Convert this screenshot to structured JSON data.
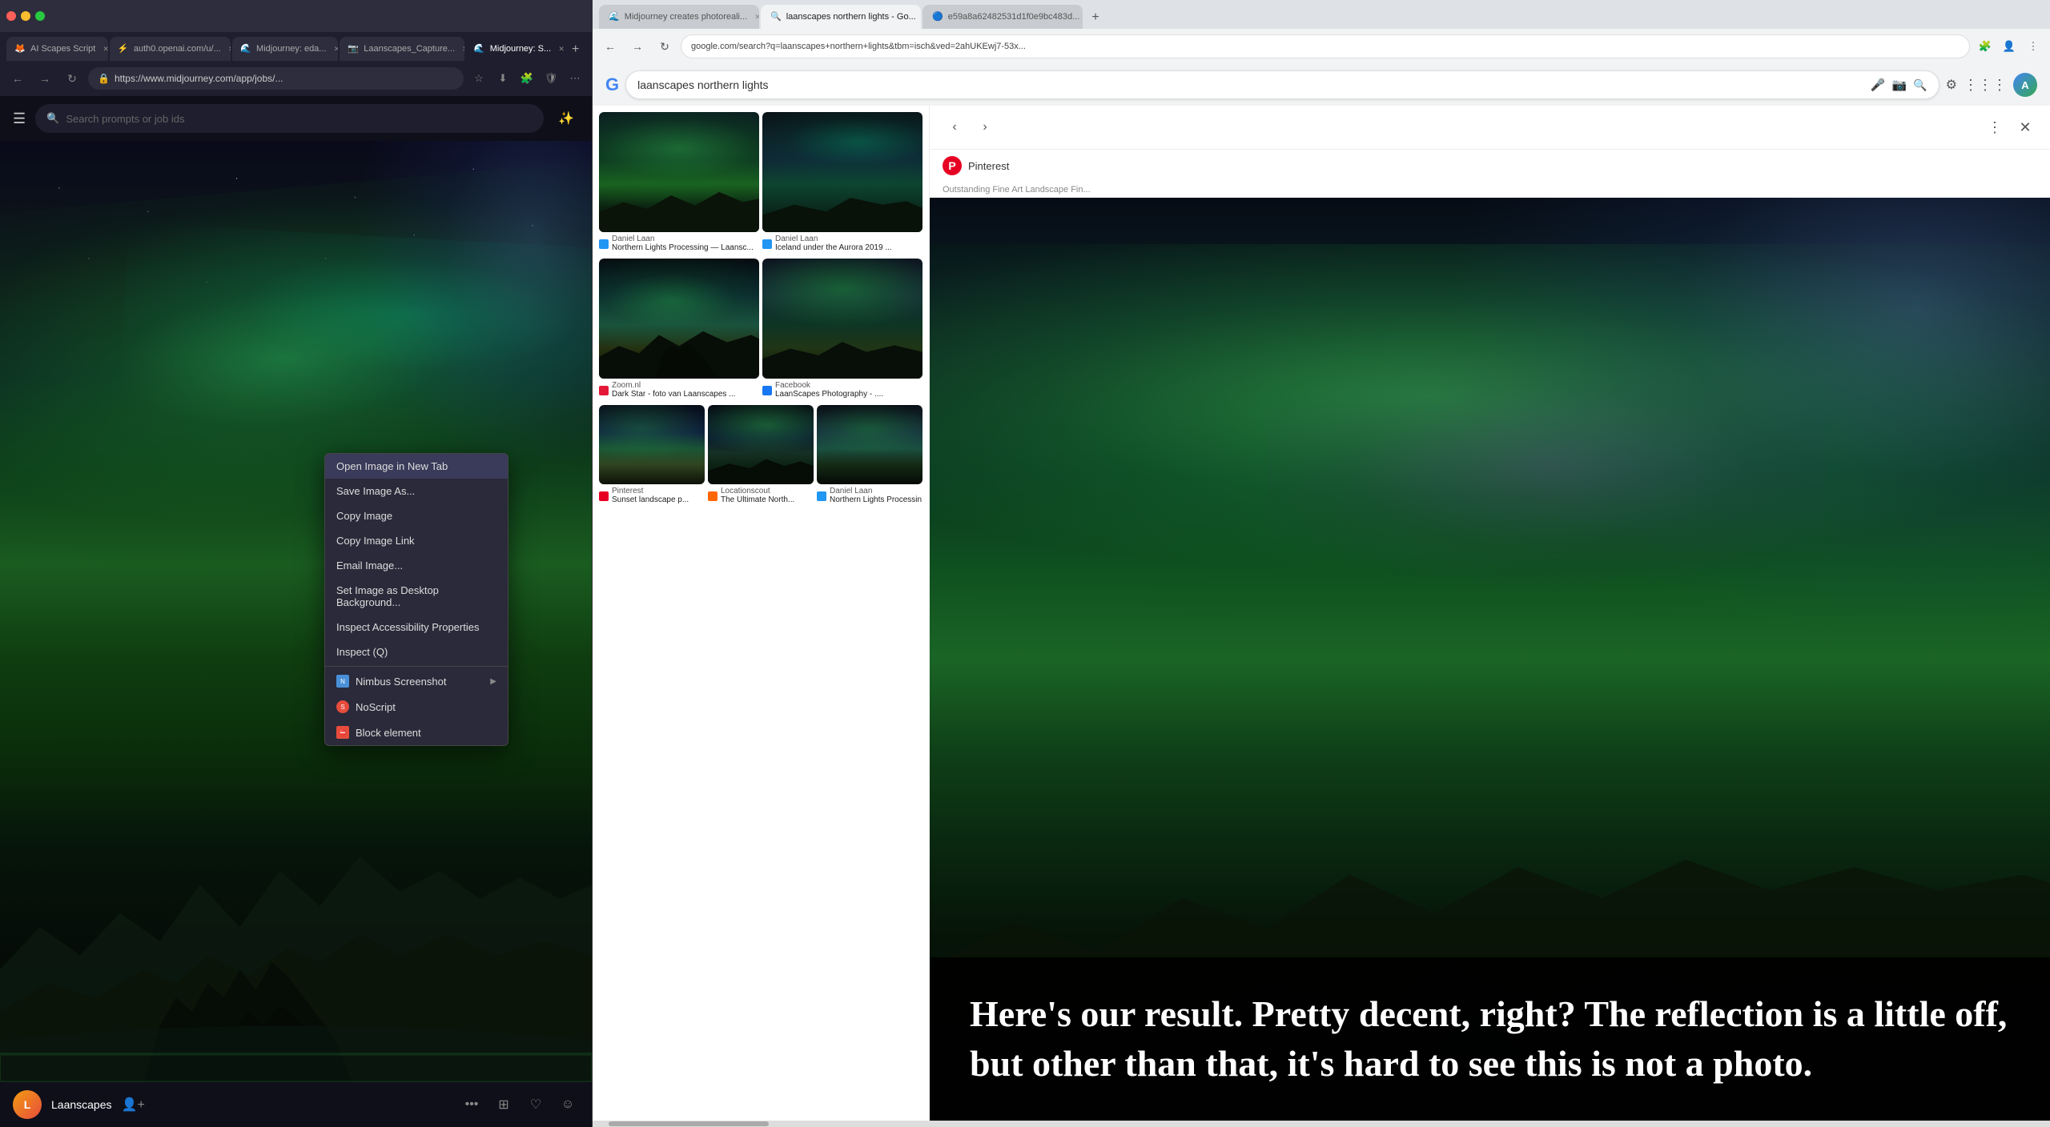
{
  "leftBrowser": {
    "tabs": [
      {
        "id": "tab1",
        "label": "AI Scapes Script",
        "favicon": "🦊",
        "active": false
      },
      {
        "id": "tab2",
        "label": "auth0.openai.com/u/...",
        "favicon": "⚡",
        "active": false
      },
      {
        "id": "tab3",
        "label": "Midjourney: eda...",
        "favicon": "🌊",
        "active": false
      },
      {
        "id": "tab4",
        "label": "Laanscapes_Capture...",
        "favicon": "📷",
        "active": false
      },
      {
        "id": "tab5",
        "label": "Midjourney: S...",
        "favicon": "🌊",
        "active": true
      }
    ],
    "address": "https://www.midjourney.com/app/jobs/...",
    "searchPlaceholder": "Search prompts or job ids",
    "userName": "Laanscapes",
    "contextMenu": {
      "items": [
        {
          "id": "open-new-tab",
          "label": "Open Image in New Tab",
          "icon": null
        },
        {
          "id": "save-image",
          "label": "Save Image As...",
          "icon": null
        },
        {
          "id": "copy-image",
          "label": "Copy Image",
          "icon": null
        },
        {
          "id": "copy-link",
          "label": "Copy Image Link",
          "icon": null
        },
        {
          "id": "email-image",
          "label": "Email Image...",
          "icon": null
        },
        {
          "id": "set-desktop",
          "label": "Set Image as Desktop Background...",
          "icon": null
        },
        {
          "id": "inspect-accessibility",
          "label": "Inspect Accessibility Properties",
          "icon": null
        },
        {
          "id": "inspect-q",
          "label": "Inspect (Q)",
          "icon": null
        },
        {
          "id": "nimbus",
          "label": "Nimbus Screenshot",
          "icon": "nimbus",
          "hasSubmenu": true
        },
        {
          "id": "noscript",
          "label": "NoScript",
          "icon": "noscript"
        },
        {
          "id": "block-element",
          "label": "Block element",
          "icon": "block"
        }
      ]
    }
  },
  "rightBrowser": {
    "tabs": [
      {
        "id": "tab1",
        "label": "Midjourney creates photoreali...",
        "active": false
      },
      {
        "id": "tab2",
        "label": "laanscapes northern lights - Go...",
        "active": true
      },
      {
        "id": "tab3",
        "label": "e59a8a62482531d1f0e9bc483d...",
        "active": false
      }
    ],
    "address": "google.com/search?q=laanscapes+northern+lights&tbm=isch&ved=2ahUKEwj7-53x...",
    "searchQuery": "laanscapes northern lights",
    "imageGrid": {
      "rows": [
        {
          "images": [
            {
              "alt": "Northern lights landscape",
              "source": "Daniel Laan",
              "title": "Northern Lights Processing — Laansc...",
              "favicon": "daniellaan"
            },
            {
              "alt": "Iceland aurora",
              "source": "Daniel Laan",
              "title": "Iceland under the Aurora 2019 ...",
              "favicon": "daniellaan"
            }
          ]
        },
        {
          "images": [
            {
              "alt": "Dark Star aurora",
              "source": "Zoom.nl",
              "title": "Dark Star - foto van Laanscapes ...",
              "favicon": "zoom"
            },
            {
              "alt": "Laanscapes Photography",
              "source": "Facebook",
              "title": "LaanScapes Photography - ....",
              "favicon": "facebook"
            }
          ]
        },
        {
          "images": [
            {
              "alt": "Sunset landscape",
              "source": "Pinterest",
              "title": "Sunset landscape p...",
              "favicon": "pinterest"
            },
            {
              "alt": "Northern lights ultimate",
              "source": "Locationscout",
              "title": "The Ultimate North...",
              "favicon": "locationscout"
            },
            {
              "alt": "Northern lights processing",
              "source": "Daniel Laan",
              "title": "Northern Lights Processin...",
              "favicon": "daniellaan"
            }
          ]
        }
      ]
    },
    "detailPanel": {
      "source": "Pinterest",
      "imageTitle": "Outstanding Fine Art Landscape Fin...",
      "navPrev": "‹",
      "navNext": "›"
    }
  },
  "textOverlay": {
    "text": "Here's our result. Pretty decent, right? The reflection is a little off, but other than that, it's hard to see this is not a photo."
  }
}
